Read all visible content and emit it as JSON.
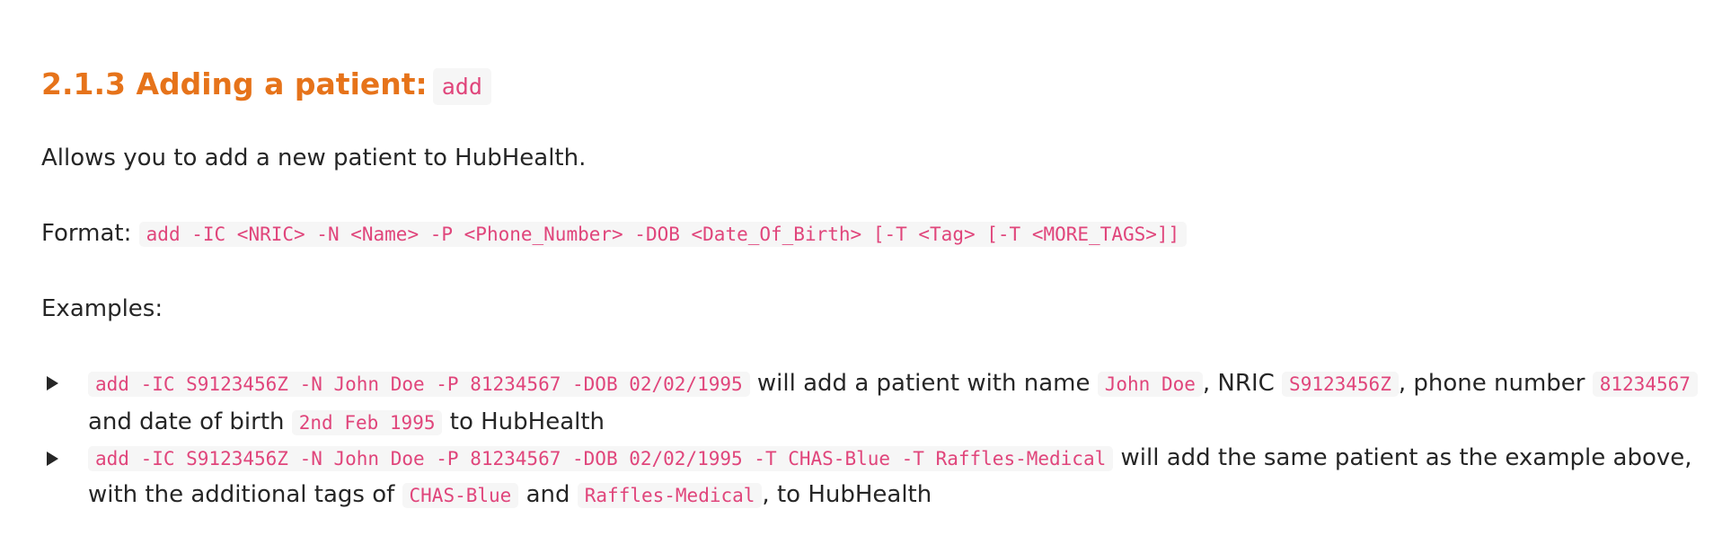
{
  "section": {
    "heading_text": "2.1.3 Adding a patient:",
    "heading_code": "add"
  },
  "description": "Allows you to add a new patient to HubHealth.",
  "format": {
    "label": "Format:",
    "code": "add -IC <NRIC> -N <Name> -P <Phone_Number> -DOB <Date_Of_Birth> [-T <Tag> [-T <MORE_TAGS>]]"
  },
  "examples_label": "Examples:",
  "examples": [
    {
      "command": "add -IC S9123456Z -N John Doe -P 81234567 -DOB 02/02/1995",
      "t1": "will add a patient with name",
      "name": "John Doe",
      "t2": ", NRIC",
      "nric": "S9123456Z",
      "t3": ", phone number",
      "phone": "81234567",
      "t4": "and date of birth",
      "dob": "2nd Feb 1995",
      "t5": "to HubHealth"
    },
    {
      "command": "add -IC S9123456Z -N John Doe -P 81234567 -DOB 02/02/1995 -T CHAS-Blue -T Raffles-Medical",
      "t1": "will add the same patient as the example above, with the additional tags of",
      "tag1": "CHAS-Blue",
      "t2": "and",
      "tag2": "Raffles-Medical",
      "t3": ", to HubHealth"
    }
  ],
  "icons": {
    "bullet": "disclosure-triangle-right"
  },
  "colors": {
    "heading": "#e6731a",
    "code_text": "#e0457b",
    "code_background": "#f6f6f6",
    "body_text": "#262626"
  }
}
